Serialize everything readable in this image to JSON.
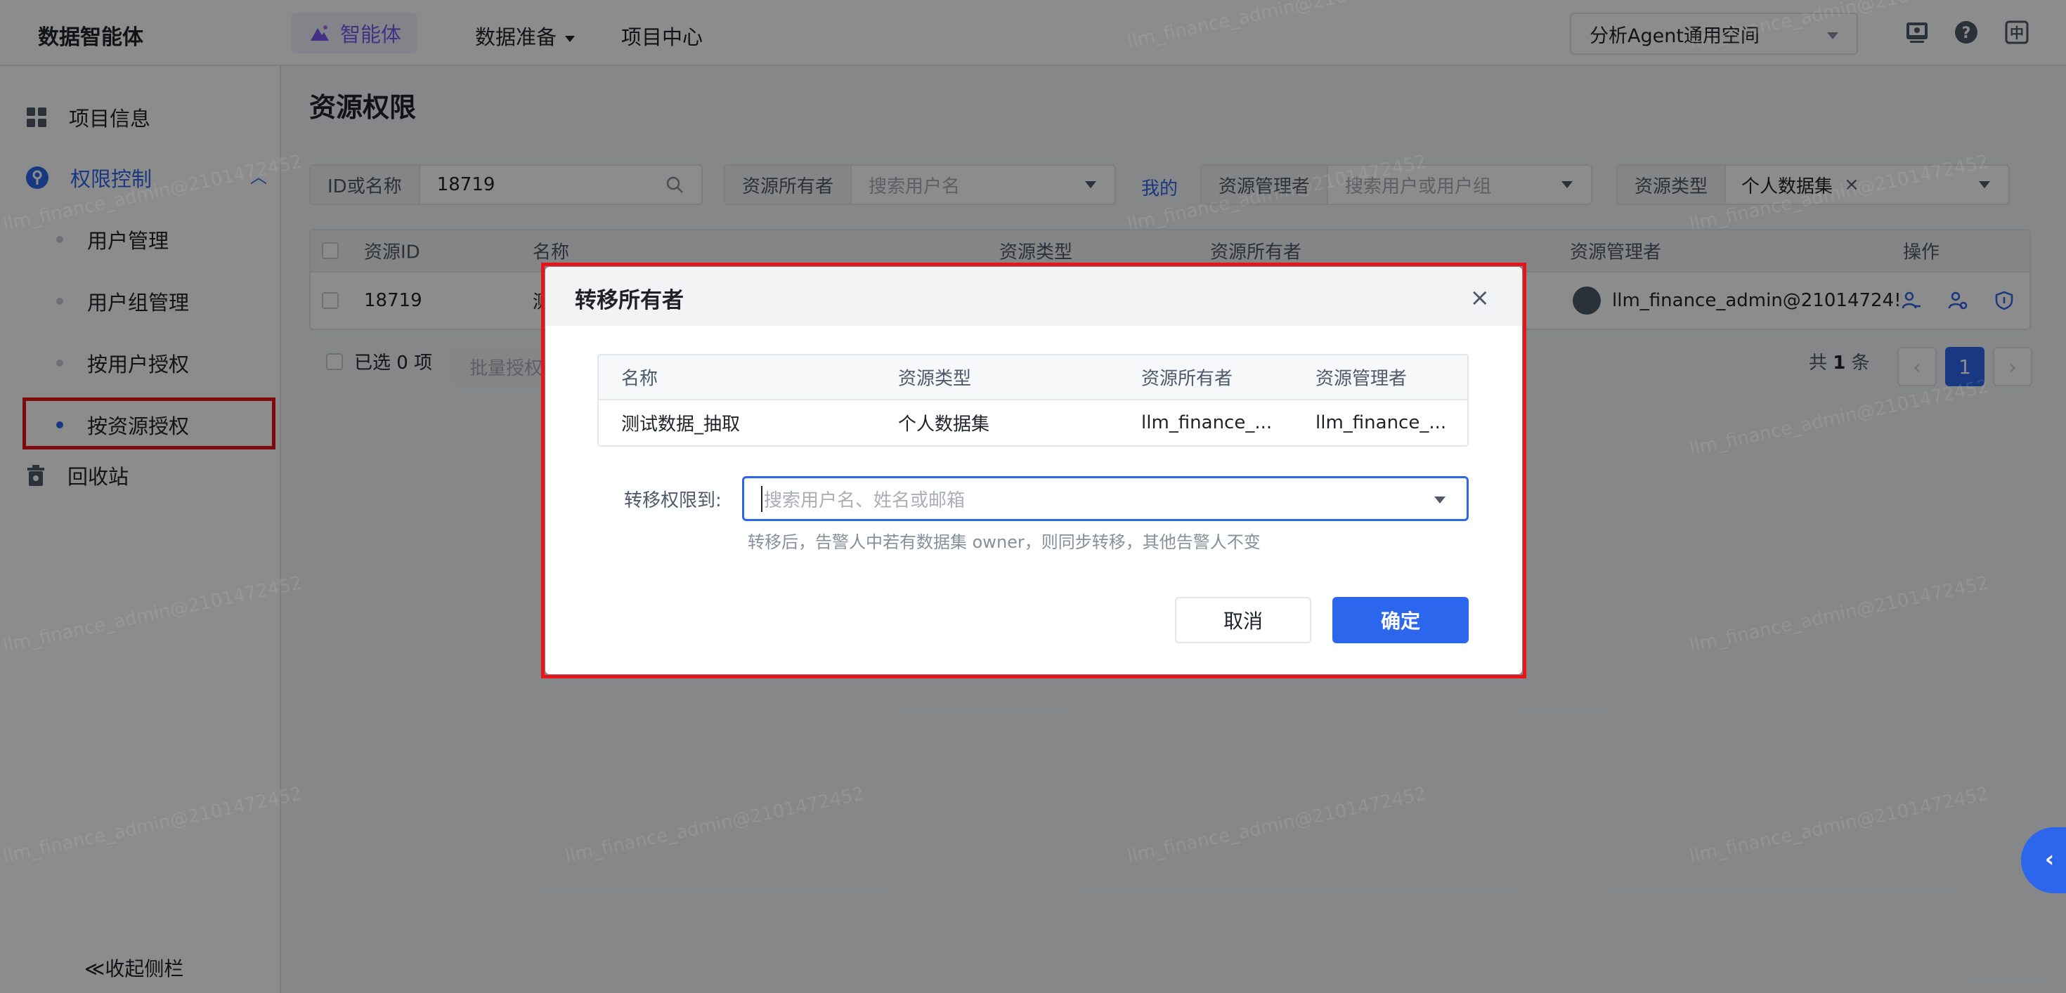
{
  "topbar": {
    "brand": "数据智能体",
    "nav": {
      "agent": "智能体",
      "data_prep": "数据准备",
      "project_center": "项目中心"
    },
    "workspace": "分析Agent通用空间",
    "icons": [
      "monitor-icon",
      "help-icon",
      "language-icon"
    ]
  },
  "sidebar": {
    "project_info": "项目信息",
    "permission_control": "权限控制",
    "sub_items": [
      "用户管理",
      "用户组管理",
      "按用户授权",
      "按资源授权"
    ],
    "recycle_bin": "回收站",
    "collapse": "≪收起侧栏"
  },
  "main": {
    "title": "资源权限",
    "filters": {
      "id_or_name_label": "ID或名称",
      "id_or_name_value": "18719",
      "owner_label": "资源所有者",
      "owner_placeholder": "搜索用户名",
      "mine_link": "我的",
      "manager_label": "资源管理者",
      "manager_placeholder": "搜索用户或用户组",
      "type_label": "资源类型",
      "type_tag": "个人数据集"
    },
    "table": {
      "headers": [
        "资源ID",
        "名称",
        "资源类型",
        "资源所有者",
        "资源管理者",
        "操作"
      ],
      "row": {
        "id": "18719",
        "name_partial": "测",
        "manager": "llm_finance_admin@21014724!"
      }
    },
    "footer": {
      "selected": "已选 0 项",
      "batch": "批量授权",
      "total_prefix": "共 ",
      "total_count": "1",
      "total_suffix": " 条",
      "page": "1"
    }
  },
  "watermark": "llm_finance_admin@2101472452",
  "modal": {
    "title": "转移所有者",
    "close": "×",
    "headers": [
      "名称",
      "资源类型",
      "资源所有者",
      "资源管理者"
    ],
    "row": [
      "测试数据_抽取",
      "个人数据集",
      "llm_finance_...",
      "llm_finance_..."
    ],
    "transfer_label": "转移权限到:",
    "transfer_placeholder": "搜索用户名、姓名或邮箱",
    "hint": "转移后，告警人中若有数据集 owner，则同步转移，其他告警人不变",
    "cancel": "取消",
    "confirm": "确定"
  },
  "colors": {
    "primary": "#2c66ec",
    "highlight": "#e8141b",
    "agent": "#7b5cf0"
  }
}
